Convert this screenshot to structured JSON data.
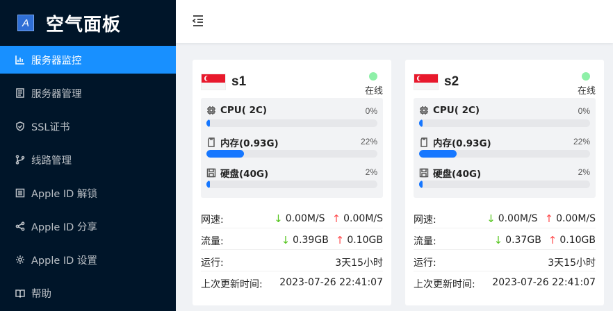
{
  "app": {
    "logo_letter": "A",
    "title": "空气面板"
  },
  "sidebar": {
    "items": [
      {
        "label": "服务器监控",
        "icon": "chart-icon",
        "active": true
      },
      {
        "label": "服务器管理",
        "icon": "server-list-icon",
        "active": false
      },
      {
        "label": "SSL证书",
        "icon": "shield-icon",
        "active": false
      },
      {
        "label": "线路管理",
        "icon": "branch-icon",
        "active": false
      },
      {
        "label": "Apple ID 解锁",
        "icon": "list-icon",
        "active": false
      },
      {
        "label": "Apple ID 分享",
        "icon": "share-icon",
        "active": false
      },
      {
        "label": "Apple ID 设置",
        "icon": "gear-icon",
        "active": false
      },
      {
        "label": "帮助",
        "icon": "book-icon",
        "active": false
      }
    ]
  },
  "servers": [
    {
      "name": "s1",
      "flag": "Singapore",
      "status": "在线",
      "status_color": "#8ef0a8",
      "cpu": {
        "label": "CPU( 2C)",
        "pct": "0%",
        "value": 0
      },
      "mem": {
        "label": "内存(0.93G)",
        "pct": "22%",
        "value": 22
      },
      "disk": {
        "label": "硬盘(40G)",
        "pct": "2%",
        "value": 2
      },
      "speed_label": "网速:",
      "speed_down": "0.00M/S",
      "speed_up": "0.00M/S",
      "traffic_label": "流量:",
      "traffic_down": "0.39GB",
      "traffic_up": "0.10GB",
      "uptime_label": "运行:",
      "uptime": "3天15小时",
      "updated_label": "上次更新时间:",
      "updated": "2023-07-26 22:41:07"
    },
    {
      "name": "s2",
      "flag": "Singapore",
      "status": "在线",
      "status_color": "#8ef0a8",
      "cpu": {
        "label": "CPU( 2C)",
        "pct": "0%",
        "value": 0
      },
      "mem": {
        "label": "内存(0.93G)",
        "pct": "22%",
        "value": 22
      },
      "disk": {
        "label": "硬盘(40G)",
        "pct": "2%",
        "value": 2
      },
      "speed_label": "网速:",
      "speed_down": "0.00M/S",
      "speed_up": "0.00M/S",
      "traffic_label": "流量:",
      "traffic_down": "0.37GB",
      "traffic_up": "0.10GB",
      "uptime_label": "运行:",
      "uptime": "3天15小时",
      "updated_label": "上次更新时间:",
      "updated": "2023-07-26 22:41:07"
    }
  ],
  "colors": {
    "sidebar_bg": "#001529",
    "accent": "#1890ff",
    "bar_fill": "#1677ff",
    "down_arrow": "#52c41a",
    "up_arrow": "#ff4d4f"
  }
}
